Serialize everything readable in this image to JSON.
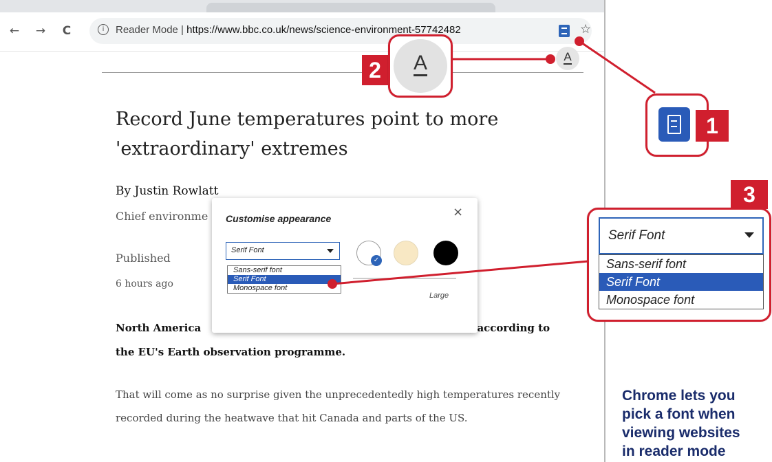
{
  "browser": {
    "nav": {
      "back_icon": "←",
      "forward_icon": "→",
      "reload_icon": "C"
    },
    "omnibox": {
      "info_icon": "ⓘ",
      "label": "Reader Mode",
      "separator": " | ",
      "url": "https://www.bbc.co.uk/news/science-environment-57742482"
    },
    "star_icon": "☆",
    "font_button_letter": "A"
  },
  "article": {
    "headline": "Record June temperatures point to more 'extraordinary' extremes",
    "byline": "By Justin Rowlatt",
    "role": "Chief environme",
    "published_label": "Published",
    "published_time": "6 hours ago",
    "bold_para_start": "North America",
    "bold_para_mid": ", according to",
    "bold_para_end": "the EU's Earth observation programme.",
    "body_para": "That will come as no surprise given the unprecedentedly high temperatures recently recorded during the heatwave that hit Canada and parts of the US."
  },
  "dialog": {
    "title": "Customise appearance",
    "close": "×",
    "font_select_value": "Serif Font",
    "font_options": [
      "Sans-serif font",
      "Serif Font",
      "Monospace font"
    ],
    "selected_option_index": 1,
    "size_label_large": "Large",
    "swatches": [
      {
        "name": "white",
        "color": "#ffffff",
        "selected": true
      },
      {
        "name": "cream",
        "color": "#f8e8c4",
        "selected": false
      },
      {
        "name": "black",
        "color": "#000000",
        "selected": false
      }
    ],
    "check_icon": "✓"
  },
  "callouts": {
    "badge_1": "1",
    "badge_2": "2",
    "badge_3": "3",
    "big_a_letter": "A",
    "big_select_value": "Serif Font",
    "big_options": [
      "Sans-serif font",
      "Serif Font",
      "Monospace font"
    ]
  },
  "caption": {
    "line1": "Chrome lets you",
    "line2": "pick a font when",
    "line3": "viewing websites",
    "line4": "in reader mode"
  },
  "colors": {
    "callout_red": "#d01f2e",
    "chrome_blue": "#2d64b8",
    "caption_navy": "#1a2c6b"
  }
}
